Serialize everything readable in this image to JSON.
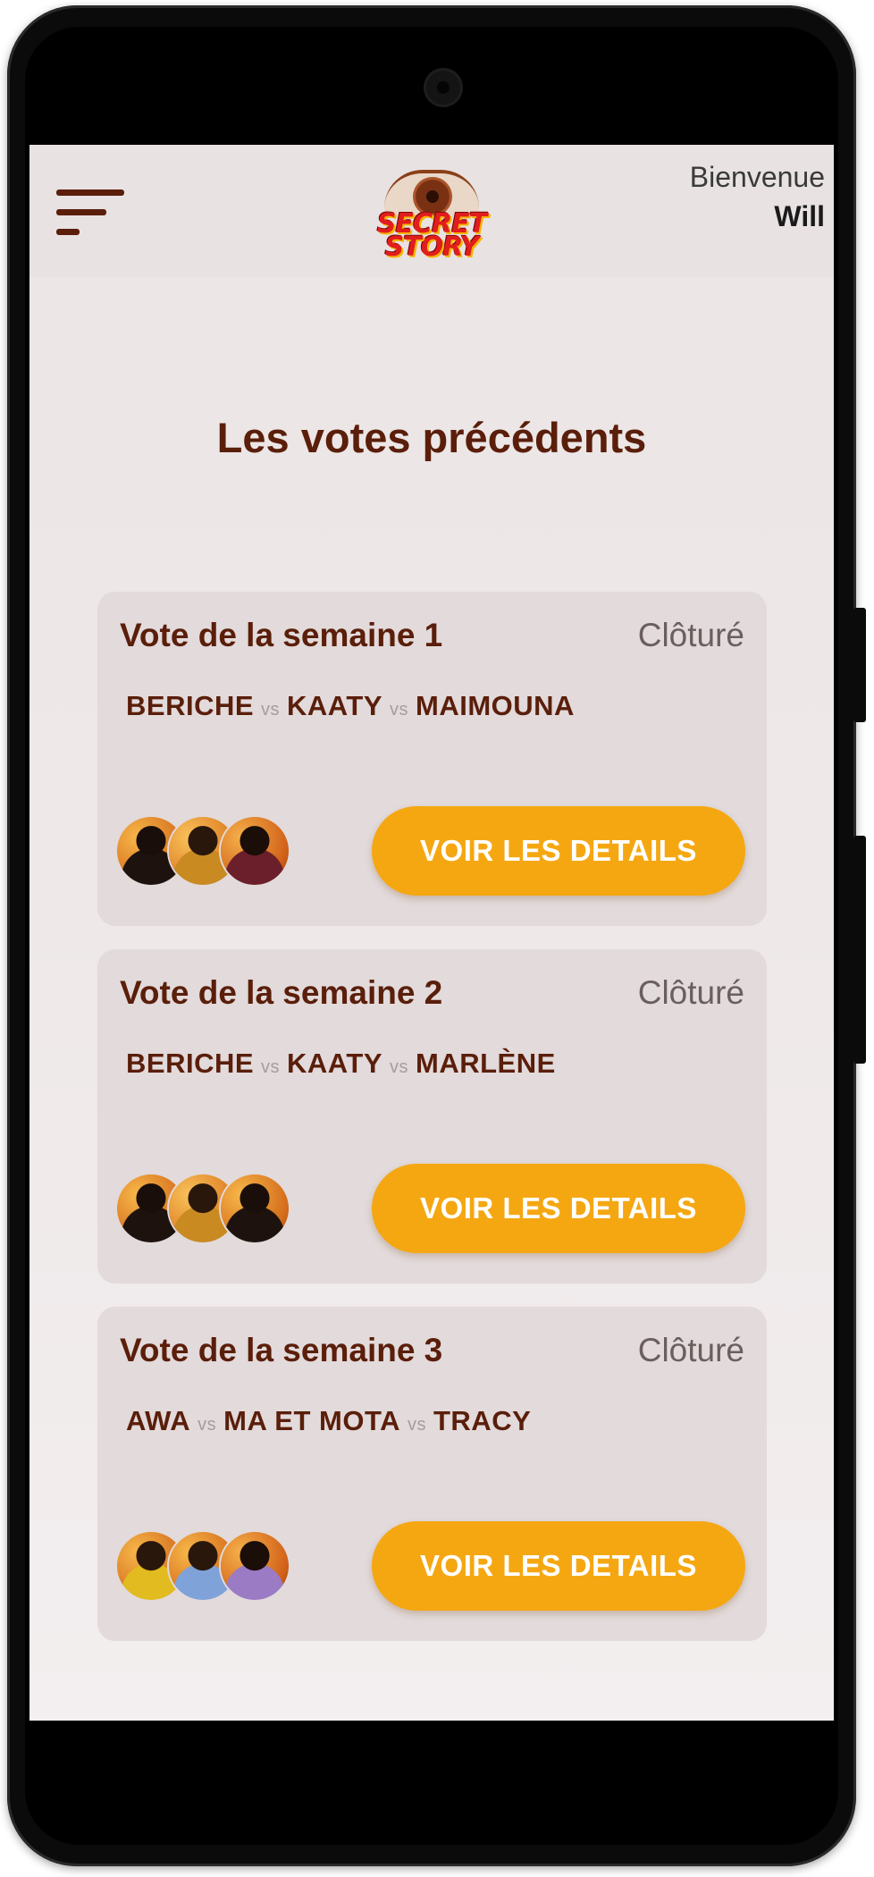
{
  "header": {
    "logo_line1": "SECRET",
    "logo_line2": "STORY",
    "greeting": "Bienvenue",
    "username": "Will"
  },
  "page": {
    "title": "Les votes précédents"
  },
  "votes": [
    {
      "title": "Vote de la semaine 1",
      "status": "Clôturé",
      "nominees": [
        "BERICHE",
        "KAATY",
        "MAIMOUNA"
      ],
      "vs_label": "vs",
      "button_label": "VOIR LES DETAILS"
    },
    {
      "title": "Vote de la semaine 2",
      "status": "Clôturé",
      "nominees": [
        "BERICHE",
        "KAATY",
        "MARLÈNE"
      ],
      "vs_label": "vs",
      "button_label": "VOIR LES DETAILS"
    },
    {
      "title": "Vote de la semaine 3",
      "status": "Clôturé",
      "nominees": [
        "AWA",
        "MA ET MOTA",
        "TRACY"
      ],
      "vs_label": "vs",
      "button_label": "VOIR LES DETAILS"
    }
  ],
  "colors": {
    "primary_text": "#5a1e0a",
    "button": "#f5a712",
    "card_bg": "#e2dadb",
    "screen_bg": "#ebe5e5"
  },
  "icons": {
    "menu": "hamburger-menu-icon",
    "camera": "front-camera"
  }
}
